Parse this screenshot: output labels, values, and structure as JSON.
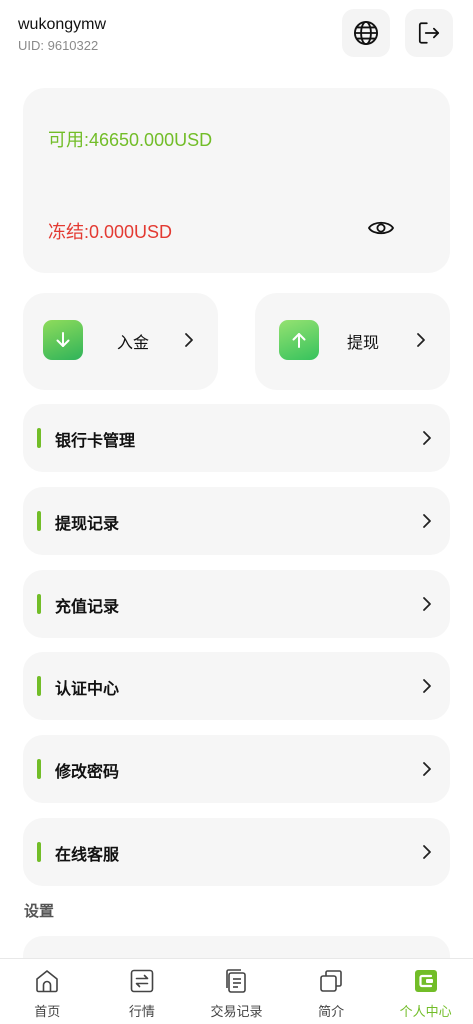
{
  "header": {
    "username": "wukongymw",
    "uid": "UID: 9610322",
    "icons": [
      "globe-icon",
      "logout-icon"
    ]
  },
  "balance": {
    "available": "可用:46650.000USD",
    "frozen": "冻结:0.000USD",
    "available_color": "#72bd28",
    "frozen_color": "#e33a32"
  },
  "actions": {
    "deposit": "入金",
    "withdraw": "提现"
  },
  "menu": {
    "items": [
      "银行卡管理",
      "提现记录",
      "充值记录",
      "认证中心",
      "修改密码",
      "在线客服"
    ]
  },
  "settings": {
    "title": "设置"
  },
  "tabbar": {
    "tabs": [
      "首页",
      "行情",
      "交易记录",
      "简介",
      "个人中心"
    ],
    "active": "个人中心",
    "accent": "#72bd28"
  }
}
